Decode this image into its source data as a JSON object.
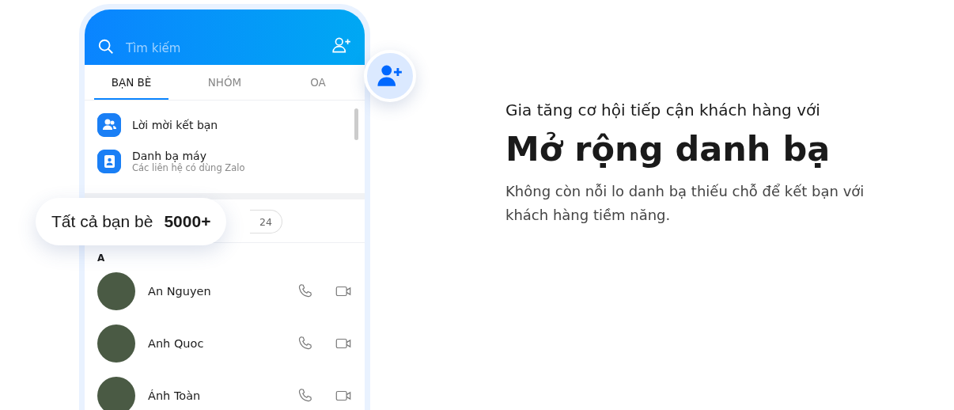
{
  "search": {
    "placeholder": "Tìm kiếm"
  },
  "tabs": [
    {
      "label": "BẠN BÈ",
      "selected": true
    },
    {
      "label": "NHÓM",
      "selected": false
    },
    {
      "label": "OA",
      "selected": false
    }
  ],
  "shortcuts": [
    {
      "kind": "requests",
      "title": "Lời mời kết bạn"
    },
    {
      "kind": "contacts",
      "title": "Danh bạ máy",
      "subtitle": "Các liên hệ có dùng Zalo"
    }
  ],
  "filter_chip": "24",
  "all_friends": {
    "label": "Tất cả bạn bè",
    "count": "5000+"
  },
  "section_letter": "A",
  "friends": [
    {
      "name": "An Nguyen"
    },
    {
      "name": "Anh Quoc"
    },
    {
      "name": "Ánh Toàn"
    }
  ],
  "tagline": "Gia tăng cơ hội tiếp cận khách hàng với",
  "headline": "Mở rộng danh bạ",
  "description": "Không còn nỗi lo danh bạ thiếu chỗ để kết bạn với khách hàng tiềm năng."
}
